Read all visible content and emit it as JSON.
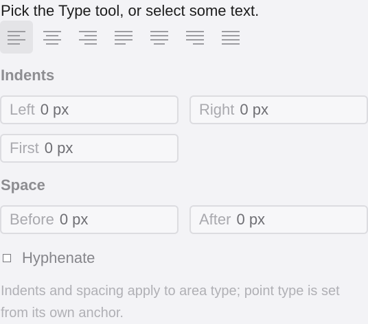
{
  "hint": "Pick the Type tool, or select some text.",
  "alignment": {
    "selected": "align-left",
    "buttons": [
      {
        "name": "align-left"
      },
      {
        "name": "align-center"
      },
      {
        "name": "align-right"
      },
      {
        "name": "justify-left"
      },
      {
        "name": "justify-center"
      },
      {
        "name": "justify-right"
      },
      {
        "name": "justify-all"
      }
    ]
  },
  "indents": {
    "title": "Indents",
    "left": {
      "label": "Left",
      "value": "0 px"
    },
    "right": {
      "label": "Right",
      "value": "0 px"
    },
    "first": {
      "label": "First",
      "value": "0 px"
    }
  },
  "space": {
    "title": "Space",
    "before": {
      "label": "Before",
      "value": "0 px"
    },
    "after": {
      "label": "After",
      "value": "0 px"
    }
  },
  "hyphenate": {
    "label": "Hyphenate",
    "checked": false
  },
  "note": "Indents and spacing apply to area type; point type is set from its own anchor.",
  "colors": {
    "background": "#f3f3f6",
    "selected_button": "#e4e4e7",
    "icon": "#9c9ca0"
  }
}
